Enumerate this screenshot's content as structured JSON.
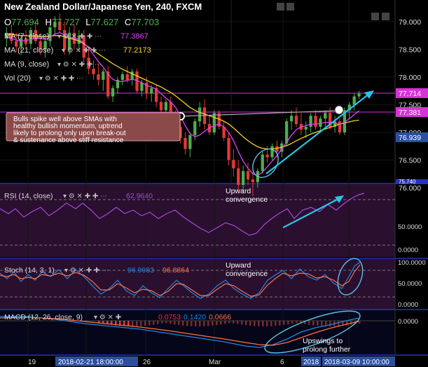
{
  "header": {
    "title": "New Zealand Dollar/Japanese Yen, 240, FXCM",
    "ohlc": [
      {
        "k": "O",
        "v": "77.694"
      },
      {
        "k": "H",
        "v": "77.727"
      },
      {
        "k": "L",
        "v": "77.627"
      },
      {
        "k": "C",
        "v": "77.703"
      }
    ]
  },
  "indicators": {
    "ma1": {
      "label": "MA (7, close)",
      "value": "77.3867",
      "color": "#e040fb"
    },
    "ma2": {
      "label": "MA (21, close)",
      "value": "77.2173",
      "color": "#f5d327"
    },
    "ma3": {
      "label": "MA (9, close)"
    },
    "vol": {
      "label": "Vol (20)"
    }
  },
  "price_badges": {
    "last": "77.714",
    "resistance": "77.381",
    "ma": "76.939",
    "bottom_partial": "75.740"
  },
  "annotation": {
    "text_lines": [
      "Bulls spike well above SMAs with",
      "healthy bullish momentum, uptrend",
      "likely to prolong only upon break-out",
      "& sustenance above stiff resistance"
    ]
  },
  "rsi": {
    "label": "RSI (14, close)",
    "value": "62.9640",
    "note": [
      "Upward",
      "convergence"
    ],
    "axis": [
      "50.0000",
      "0.0000"
    ]
  },
  "stoch": {
    "label": "Stoch (14, 3, 1)",
    "k_value": "96.9083",
    "d_value": "96.8864",
    "note": [
      "Upward",
      "convergence"
    ],
    "axis": [
      "100.0000",
      "50.0000",
      "0.0000"
    ]
  },
  "macd": {
    "label": "MACD (12, 26, close, 9)",
    "hist": "0.0753",
    "macd": "0.1420",
    "signal": "0.0666",
    "note": [
      "Upswings to",
      "prolong further"
    ],
    "axis": [
      "0.0000"
    ]
  },
  "time_axis": [
    {
      "label": "19"
    },
    {
      "label": "2018-02-21 18:00:00",
      "boxed": true
    },
    {
      "label": "26"
    },
    {
      "label": "Mar"
    },
    {
      "label": "6"
    },
    {
      "label": "2018",
      "boxed": true
    },
    {
      "label": "2018-03-09 10:00:00",
      "boxed": true
    }
  ],
  "chart_data": {
    "type": "candlestick",
    "title": "New Zealand Dollar/Japanese Yen, 240, FXCM",
    "y_ticks": [
      "79.000",
      "78.500",
      "78.000",
      "77.500",
      "77.000",
      "76.500",
      "76.000"
    ],
    "ylim": [
      75.74,
      79.1
    ],
    "candles": [
      {
        "o": 78.7,
        "h": 78.9,
        "l": 78.55,
        "c": 78.8
      },
      {
        "o": 78.8,
        "h": 78.95,
        "l": 78.6,
        "c": 78.65
      },
      {
        "o": 78.65,
        "h": 78.8,
        "l": 78.45,
        "c": 78.55
      },
      {
        "o": 78.55,
        "h": 78.75,
        "l": 78.4,
        "c": 78.7
      },
      {
        "o": 78.7,
        "h": 78.85,
        "l": 78.55,
        "c": 78.6
      },
      {
        "o": 78.6,
        "h": 78.9,
        "l": 78.5,
        "c": 78.85
      },
      {
        "o": 78.85,
        "h": 79.0,
        "l": 78.6,
        "c": 78.65
      },
      {
        "o": 78.65,
        "h": 78.8,
        "l": 78.4,
        "c": 78.5
      },
      {
        "o": 78.5,
        "h": 78.7,
        "l": 78.35,
        "c": 78.65
      },
      {
        "o": 78.65,
        "h": 78.95,
        "l": 78.55,
        "c": 78.9
      },
      {
        "o": 78.9,
        "h": 79.1,
        "l": 78.75,
        "c": 79.0
      },
      {
        "o": 79.0,
        "h": 79.15,
        "l": 78.8,
        "c": 78.85
      },
      {
        "o": 78.85,
        "h": 79.0,
        "l": 78.4,
        "c": 78.5
      },
      {
        "o": 78.5,
        "h": 78.9,
        "l": 78.4,
        "c": 78.8
      },
      {
        "o": 78.8,
        "h": 78.95,
        "l": 78.5,
        "c": 78.6
      },
      {
        "o": 78.6,
        "h": 78.85,
        "l": 78.45,
        "c": 78.75
      },
      {
        "o": 78.75,
        "h": 78.85,
        "l": 78.25,
        "c": 78.35
      },
      {
        "o": 78.35,
        "h": 78.55,
        "l": 78.05,
        "c": 78.15
      },
      {
        "o": 78.15,
        "h": 78.3,
        "l": 77.95,
        "c": 78.05
      },
      {
        "o": 78.05,
        "h": 78.25,
        "l": 77.85,
        "c": 77.95
      },
      {
        "o": 77.95,
        "h": 78.15,
        "l": 77.75,
        "c": 78.1
      },
      {
        "o": 78.1,
        "h": 78.2,
        "l": 77.6,
        "c": 77.65
      },
      {
        "o": 77.65,
        "h": 77.85,
        "l": 77.55,
        "c": 77.8
      },
      {
        "o": 77.8,
        "h": 78.0,
        "l": 77.7,
        "c": 77.95
      },
      {
        "o": 77.95,
        "h": 78.1,
        "l": 77.85,
        "c": 78.05
      },
      {
        "o": 78.05,
        "h": 78.2,
        "l": 77.9,
        "c": 77.95
      },
      {
        "o": 77.95,
        "h": 78.15,
        "l": 77.85,
        "c": 78.1
      },
      {
        "o": 78.1,
        "h": 78.15,
        "l": 77.7,
        "c": 77.75
      },
      {
        "o": 77.75,
        "h": 77.95,
        "l": 77.65,
        "c": 77.9
      },
      {
        "o": 77.9,
        "h": 78.0,
        "l": 77.6,
        "c": 77.7
      },
      {
        "o": 77.7,
        "h": 77.85,
        "l": 77.55,
        "c": 77.8
      },
      {
        "o": 77.8,
        "h": 77.85,
        "l": 77.45,
        "c": 77.55
      },
      {
        "o": 77.55,
        "h": 77.65,
        "l": 77.3,
        "c": 77.4
      },
      {
        "o": 77.4,
        "h": 77.6,
        "l": 77.35,
        "c": 77.55
      },
      {
        "o": 77.55,
        "h": 77.65,
        "l": 77.25,
        "c": 77.3
      },
      {
        "o": 77.3,
        "h": 77.4,
        "l": 77.0,
        "c": 77.1
      },
      {
        "o": 77.1,
        "h": 77.2,
        "l": 76.8,
        "c": 76.9
      },
      {
        "o": 76.9,
        "h": 77.0,
        "l": 76.6,
        "c": 76.7
      },
      {
        "o": 76.7,
        "h": 77.0,
        "l": 76.55,
        "c": 76.95
      },
      {
        "o": 76.95,
        "h": 77.25,
        "l": 76.85,
        "c": 77.2
      },
      {
        "o": 77.2,
        "h": 77.55,
        "l": 77.1,
        "c": 77.45
      },
      {
        "o": 77.45,
        "h": 77.6,
        "l": 77.05,
        "c": 77.15
      },
      {
        "o": 77.15,
        "h": 77.3,
        "l": 76.95,
        "c": 77.0
      },
      {
        "o": 77.0,
        "h": 77.4,
        "l": 76.95,
        "c": 77.35
      },
      {
        "o": 77.35,
        "h": 77.4,
        "l": 77.05,
        "c": 77.1
      },
      {
        "o": 77.1,
        "h": 77.2,
        "l": 76.85,
        "c": 76.9
      },
      {
        "o": 76.9,
        "h": 77.0,
        "l": 76.4,
        "c": 76.5
      },
      {
        "o": 76.5,
        "h": 76.7,
        "l": 76.2,
        "c": 76.35
      },
      {
        "o": 76.35,
        "h": 76.5,
        "l": 75.95,
        "c": 76.05
      },
      {
        "o": 76.05,
        "h": 76.4,
        "l": 75.9,
        "c": 76.3
      },
      {
        "o": 76.3,
        "h": 76.45,
        "l": 76.05,
        "c": 76.15
      },
      {
        "o": 76.15,
        "h": 76.3,
        "l": 75.85,
        "c": 76.1
      },
      {
        "o": 76.1,
        "h": 76.35,
        "l": 76.0,
        "c": 76.3
      },
      {
        "o": 76.3,
        "h": 76.65,
        "l": 76.25,
        "c": 76.6
      },
      {
        "o": 76.6,
        "h": 76.75,
        "l": 76.45,
        "c": 76.55
      },
      {
        "o": 76.55,
        "h": 76.8,
        "l": 76.5,
        "c": 76.75
      },
      {
        "o": 76.75,
        "h": 76.85,
        "l": 76.55,
        "c": 76.65
      },
      {
        "o": 76.65,
        "h": 76.85,
        "l": 76.55,
        "c": 76.8
      },
      {
        "o": 76.8,
        "h": 77.25,
        "l": 76.75,
        "c": 77.2
      },
      {
        "o": 77.2,
        "h": 77.4,
        "l": 77.05,
        "c": 77.3
      },
      {
        "o": 77.3,
        "h": 77.45,
        "l": 77.1,
        "c": 77.15
      },
      {
        "o": 77.15,
        "h": 77.35,
        "l": 76.95,
        "c": 77.05
      },
      {
        "o": 77.05,
        "h": 77.2,
        "l": 76.9,
        "c": 77.1
      },
      {
        "o": 77.1,
        "h": 77.35,
        "l": 77.0,
        "c": 77.3
      },
      {
        "o": 77.3,
        "h": 77.4,
        "l": 77.05,
        "c": 77.1
      },
      {
        "o": 77.1,
        "h": 77.3,
        "l": 77.0,
        "c": 77.25
      },
      {
        "o": 77.25,
        "h": 77.4,
        "l": 77.1,
        "c": 77.35
      },
      {
        "o": 77.35,
        "h": 77.45,
        "l": 77.05,
        "c": 77.1
      },
      {
        "o": 77.1,
        "h": 77.3,
        "l": 77.0,
        "c": 77.2
      },
      {
        "o": 77.2,
        "h": 77.25,
        "l": 76.95,
        "c": 77.0
      },
      {
        "o": 77.0,
        "h": 77.45,
        "l": 76.95,
        "c": 77.4
      },
      {
        "o": 77.4,
        "h": 77.55,
        "l": 77.25,
        "c": 77.5
      },
      {
        "o": 77.5,
        "h": 77.7,
        "l": 77.4,
        "c": 77.65
      },
      {
        "o": 77.65,
        "h": 77.75,
        "l": 77.6,
        "c": 77.7
      }
    ],
    "sma7": [
      78.72,
      78.7,
      78.67,
      78.65,
      78.66,
      78.68,
      78.7,
      78.7,
      78.68,
      78.72,
      78.78,
      78.8,
      78.76,
      78.72,
      78.7,
      78.68,
      78.62,
      78.52,
      78.4,
      78.28,
      78.18,
      78.05,
      77.96,
      77.92,
      77.92,
      77.94,
      77.96,
      77.94,
      77.9,
      77.85,
      77.82,
      77.78,
      77.7,
      77.62,
      77.55,
      77.45,
      77.3,
      77.12,
      76.98,
      76.92,
      76.95,
      77.02,
      77.08,
      77.12,
      77.15,
      77.1,
      77.0,
      76.85,
      76.65,
      76.48,
      76.35,
      76.25,
      76.22,
      76.28,
      76.38,
      76.48,
      76.58,
      76.7,
      76.82,
      76.95,
      77.05,
      77.1,
      77.12,
      77.15,
      77.15,
      77.16,
      77.18,
      77.18,
      77.17,
      77.15,
      77.18,
      77.25,
      77.32,
      77.39
    ],
    "sma21": [
      78.78,
      78.77,
      78.76,
      78.75,
      78.75,
      78.74,
      78.74,
      78.73,
      78.73,
      78.74,
      78.75,
      78.75,
      78.73,
      78.7,
      78.68,
      78.65,
      78.6,
      78.54,
      78.48,
      78.42,
      78.36,
      78.3,
      78.24,
      78.19,
      78.14,
      78.1,
      78.06,
      78.02,
      77.98,
      77.94,
      77.9,
      77.86,
      77.82,
      77.77,
      77.72,
      77.66,
      77.59,
      77.52,
      77.45,
      77.4,
      77.36,
      77.33,
      77.3,
      77.27,
      77.24,
      77.2,
      77.15,
      77.08,
      77.0,
      76.92,
      76.85,
      76.79,
      76.74,
      76.71,
      76.7,
      76.7,
      76.71,
      76.73,
      76.76,
      76.8,
      76.85,
      76.89,
      76.93,
      76.97,
      77.0,
      77.03,
      77.06,
      77.09,
      77.12,
      77.15,
      77.17,
      77.19,
      77.21,
      77.22
    ]
  }
}
